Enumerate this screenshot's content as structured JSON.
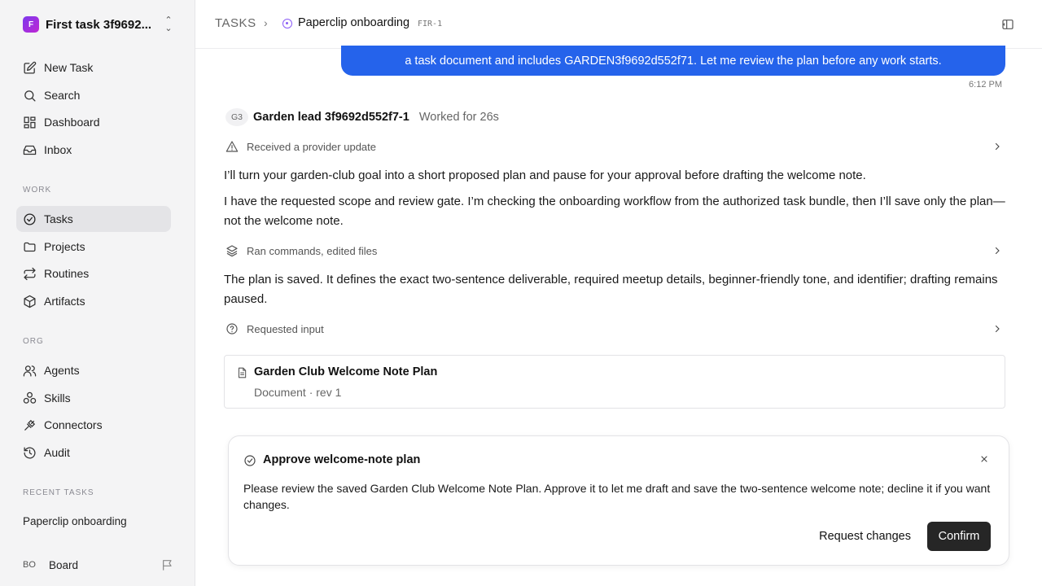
{
  "workspace": {
    "name": "First task 3f9692...",
    "logo_letter": "F"
  },
  "nav": {
    "new_task": "New Task",
    "search": "Search",
    "dashboard": "Dashboard",
    "inbox": "Inbox"
  },
  "sections": {
    "work": "WORK",
    "org": "ORG",
    "recent": "RECENT TASKS"
  },
  "work_items": {
    "tasks": "Tasks",
    "projects": "Projects",
    "routines": "Routines",
    "artifacts": "Artifacts"
  },
  "org_items": {
    "agents": "Agents",
    "skills": "Skills",
    "connectors": "Connectors",
    "audit": "Audit"
  },
  "recent_tasks": [
    "Paperclip onboarding"
  ],
  "board": {
    "initials": "BO",
    "name": "Board"
  },
  "header": {
    "root": "TASKS",
    "title": "Paperclip onboarding",
    "id": "FIR-1"
  },
  "thread": {
    "user_message_tail": "a task document and includes GARDEN3f9692d552f71. Let me review the plan before any work starts.",
    "user_time": "6:12 PM",
    "agent": {
      "initials": "G3",
      "name": "Garden lead 3f9692d552f7-1",
      "worked": "Worked for 26s"
    },
    "activity1": "Received a provider update",
    "para1": "I’ll turn your garden-club goal into a short proposed plan and pause for your approval before drafting the welcome note.",
    "para2": "I have the requested scope and review gate. I’m checking the onboarding workflow from the authorized task bundle, then I’ll save only the plan—not the welcome note.",
    "activity2": "Ran commands, edited files",
    "para3": "The plan is saved. It defines the exact two-sentence deliverable, required meetup details, beginner-friendly tone, and identifier; drafting remains paused.",
    "activity3": "Requested input",
    "document": {
      "title": "Garden Club Welcome Note Plan",
      "meta": "Document · rev 1"
    }
  },
  "approval": {
    "title": "Approve welcome-note plan",
    "body": "Please review the saved Garden Club Welcome Note Plan. Approve it to let me draft and save the two-sentence welcome note; decline it if you want changes.",
    "secondary": "Request changes",
    "primary": "Confirm"
  },
  "colors": {
    "accent": "#2563eb",
    "status": "#8b5cf6",
    "primary_button": "#262626"
  }
}
